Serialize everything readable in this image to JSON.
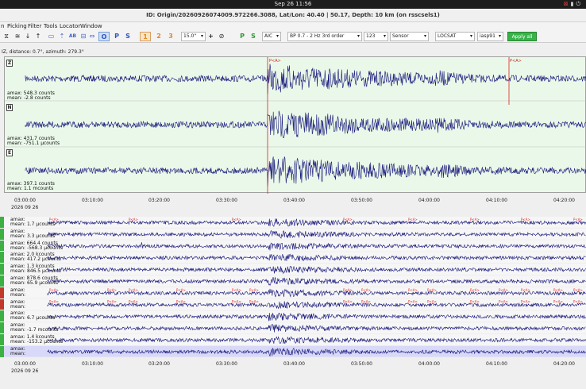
{
  "system": {
    "clock": "Sep 26  11:56"
  },
  "window": {
    "title": "ID: Origin/20260926074009.972266.3088, Lat/Lon: 40.40 | 50.17, Depth: 10 km (on rsscsels1)"
  },
  "menu": [
    "n",
    "Picking",
    "Filter",
    "Tools",
    "Locator",
    "Window"
  ],
  "toolbar": {
    "zoom": "15.0\"",
    "phase_select": "AIC",
    "filter": "BP 0.7 - 2 Hz  3rd order",
    "mode": "123",
    "sensor": "Sensor",
    "locator": "LOCSAT",
    "profile": "iasp91",
    "apply_all": "Apply all",
    "buttons": [
      "1",
      "2",
      "3"
    ],
    "tools": [
      "O",
      "P",
      "S",
      "P",
      "S"
    ]
  },
  "info": "IZ, distance: 0.7°, azimuth: 279.3°",
  "top_traces": [
    {
      "label": "Z",
      "amax": "amax: 548.3 counts",
      "mean": "mean: -2.8 counts"
    },
    {
      "label": "N",
      "amax": "amax: 431.7 counts",
      "mean": "mean: -751.1 µcounts"
    },
    {
      "label": "E",
      "amax": "amax: 397.1 counts",
      "mean": "mean: 1.1 mcounts"
    }
  ],
  "pick_label": "P<A>",
  "time_ticks": [
    "03:00:00",
    "03:10:00",
    "03:20:00",
    "03:30:00",
    "03:40:00",
    "03:50:00",
    "04:00:00",
    "04:10:00",
    "04:20:00"
  ],
  "date": "2026 09 26",
  "bottom_rows": [
    {
      "amax": "amax: ",
      "mean": "mean: 1.7 µcounts",
      "bar": "#3cb043"
    },
    {
      "amax": "amax: ",
      "mean": "mean: 3.3 µcounts",
      "bar": "#3cb043"
    },
    {
      "amax": "amax: 664.4 counts",
      "mean": "mean: -568.3 µcounts",
      "bar": "#3cb043"
    },
    {
      "amax": "amax: 2.0 kcounts",
      "mean": "mean: 417.2 µcounts",
      "bar": "#3cb043"
    },
    {
      "amax": "amax: 1.3 kcounts",
      "mean": "mean: 846.5 µcounts",
      "bar": "#3cb043"
    },
    {
      "amax": "amax: 878.6 counts",
      "mean": "mean: 65.9 µcounts",
      "bar": "#3cb043"
    },
    {
      "amax": "amax: ",
      "mean": "mean: ",
      "bar": "#c0392b"
    },
    {
      "amax": "amax: ",
      "mean": "mean: ",
      "bar": "#c0392b"
    },
    {
      "amax": "amax: ",
      "mean": "mean: 6.7 µcounts",
      "bar": "#3cb043"
    },
    {
      "amax": "amax: ",
      "mean": "mean: -1.7 mcounts",
      "bar": "#3cb043"
    },
    {
      "amax": "amax: 1.4 kcounts",
      "mean": "mean: -153.2 µcounts",
      "bar": "#3cb043"
    },
    {
      "amax": "amax: ",
      "mean": "mean: ",
      "bar": "#3cb043"
    }
  ],
  "colors": {
    "trace": "#16167a",
    "pick": "#e02020",
    "plot_bg": "#eaf8e9",
    "row_alt": "#d8d8f8"
  }
}
